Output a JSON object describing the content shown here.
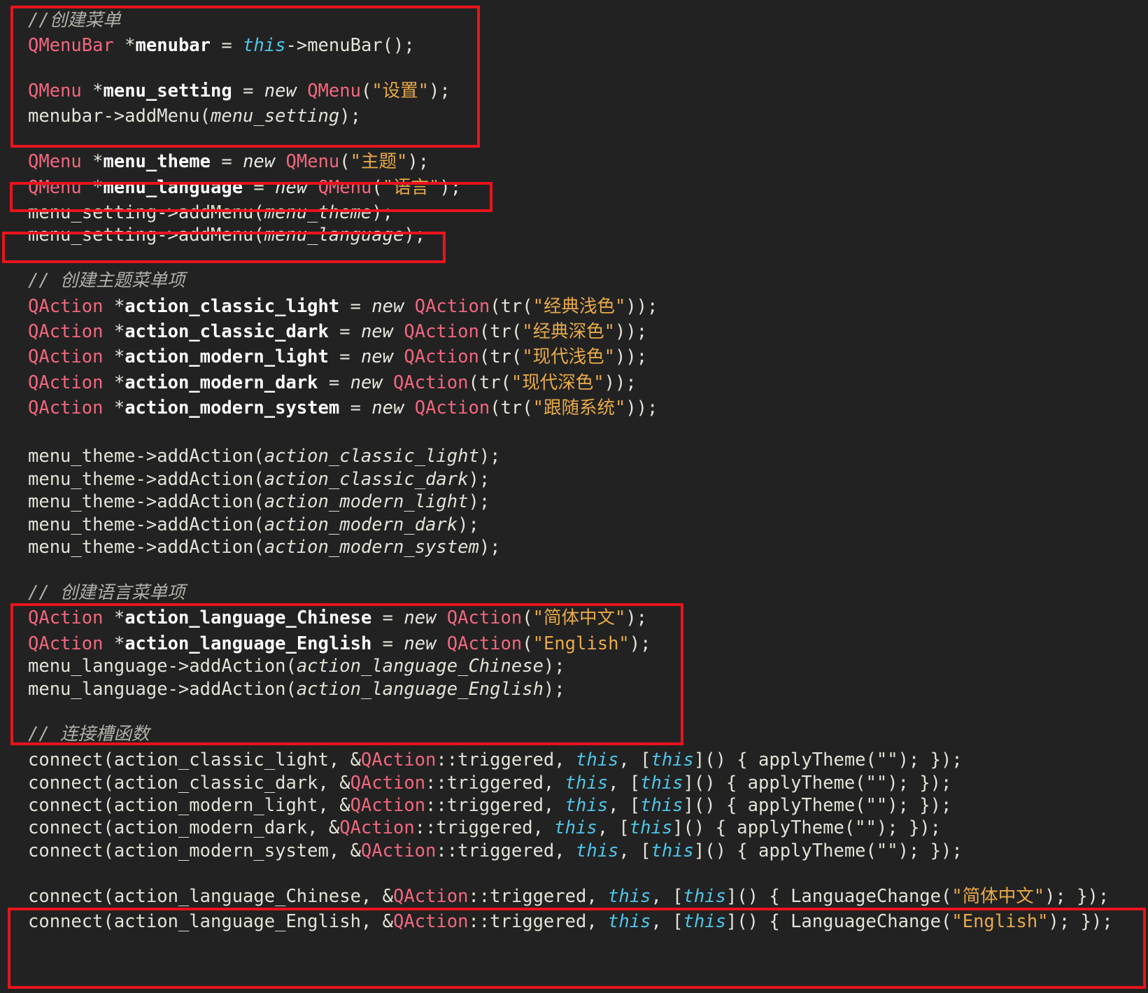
{
  "code": {
    "l1": {
      "comment": "//创建菜单"
    },
    "l2": {
      "type": "QMenuBar",
      "star": " *",
      "var": "menubar",
      "eq": " = ",
      "this": "this",
      "rest": "->menuBar();"
    },
    "l3": {
      "type": "QMenu",
      "star": " *",
      "var": "menu_setting",
      "eq": " = ",
      "new": "new",
      "sp": " ",
      "ctor": "QMenu",
      "open": "(",
      "str": "\"设置\"",
      "close": ");"
    },
    "l4": {
      "pre": "menubar->addMenu(",
      "arg": "menu_setting",
      "post": ");"
    },
    "l5": {
      "type": "QMenu",
      "star": " *",
      "var": "menu_theme",
      "eq": " = ",
      "new": "new",
      "sp": " ",
      "ctor": "QMenu",
      "open": "(",
      "str": "\"主题\"",
      "close": ");"
    },
    "l6": {
      "type": "QMenu",
      "star": " *",
      "var": "menu_language",
      "eq": " = ",
      "new": "new",
      "sp": " ",
      "ctor": "QMenu",
      "open": "(",
      "str": "\"语言\"",
      "close": ");"
    },
    "l7": {
      "pre": "menu_setting->addMenu(",
      "arg": "menu_theme",
      "post": ");"
    },
    "l8": {
      "pre": "menu_setting->addMenu(",
      "arg": "menu_language",
      "post": ");"
    },
    "l9": {
      "comment": "// 创建主题菜单项"
    },
    "l10": {
      "type": "QAction",
      "star": " *",
      "var": "action_classic_light",
      "eq": " = ",
      "new": "new",
      "sp": " ",
      "ctor": "QAction",
      "open": "(tr(",
      "str": "\"经典浅色\"",
      "close": "));"
    },
    "l11": {
      "type": "QAction",
      "star": " *",
      "var": "action_classic_dark",
      "eq": " = ",
      "new": "new",
      "sp": " ",
      "ctor": "QAction",
      "open": "(tr(",
      "str": "\"经典深色\"",
      "close": "));"
    },
    "l12": {
      "type": "QAction",
      "star": " *",
      "var": "action_modern_light",
      "eq": " = ",
      "new": "new",
      "sp": " ",
      "ctor": "QAction",
      "open": "(tr(",
      "str": "\"现代浅色\"",
      "close": "));"
    },
    "l13": {
      "type": "QAction",
      "star": " *",
      "var": "action_modern_dark",
      "eq": " = ",
      "new": "new",
      "sp": " ",
      "ctor": "QAction",
      "open": "(tr(",
      "str": "\"现代深色\"",
      "close": "));"
    },
    "l14": {
      "type": "QAction",
      "star": " *",
      "var": "action_modern_system",
      "eq": " = ",
      "new": "new",
      "sp": " ",
      "ctor": "QAction",
      "open": "(tr(",
      "str": "\"跟随系统\"",
      "close": "));"
    },
    "l15": {
      "pre": "menu_theme->addAction(",
      "arg": "action_classic_light",
      "post": ");"
    },
    "l16": {
      "pre": "menu_theme->addAction(",
      "arg": "action_classic_dark",
      "post": ");"
    },
    "l17": {
      "pre": "menu_theme->addAction(",
      "arg": "action_modern_light",
      "post": ");"
    },
    "l18": {
      "pre": "menu_theme->addAction(",
      "arg": "action_modern_dark",
      "post": ");"
    },
    "l19": {
      "pre": "menu_theme->addAction(",
      "arg": "action_modern_system",
      "post": ");"
    },
    "l20": {
      "comment": "// 创建语言菜单项"
    },
    "l21": {
      "type": "QAction",
      "star": " *",
      "var": "action_language_Chinese",
      "eq": " = ",
      "new": "new",
      "sp": " ",
      "ctor": "QAction",
      "open": "(",
      "str": "\"简体中文\"",
      "close": ");"
    },
    "l22": {
      "type": "QAction",
      "star": " *",
      "var": "action_language_English",
      "eq": " = ",
      "new": "new",
      "sp": " ",
      "ctor": "QAction",
      "open": "(",
      "str": "\"English\"",
      "close": ");"
    },
    "l23": {
      "pre": "menu_language->addAction(",
      "arg": "action_language_Chinese",
      "post": ");"
    },
    "l24": {
      "pre": "menu_language->addAction(",
      "arg": "action_language_English",
      "post": ");"
    },
    "l25": {
      "comment": "// 连接槽函数"
    },
    "l26": {
      "pre": "connect(action_classic_light, &",
      "cls": "QAction",
      "mid": "::triggered, ",
      "this1": "this",
      "sep": ", [",
      "this2": "this",
      "post": "]() { applyTheme(\"\"); });"
    },
    "l27": {
      "pre": "connect(action_classic_dark, &",
      "cls": "QAction",
      "mid": "::triggered, ",
      "this1": "this",
      "sep": ", [",
      "this2": "this",
      "post": "]() { applyTheme(\"\"); });"
    },
    "l28": {
      "pre": "connect(action_modern_light, &",
      "cls": "QAction",
      "mid": "::triggered, ",
      "this1": "this",
      "sep": ", [",
      "this2": "this",
      "post": "]() { applyTheme(\"\"); });"
    },
    "l29": {
      "pre": "connect(action_modern_dark, &",
      "cls": "QAction",
      "mid": "::triggered, ",
      "this1": "this",
      "sep": ", [",
      "this2": "this",
      "post": "]() { applyTheme(\"\"); });"
    },
    "l30": {
      "pre": "connect(action_modern_system, &",
      "cls": "QAction",
      "mid": "::triggered, ",
      "this1": "this",
      "sep": ", [",
      "this2": "this",
      "post": "]() { applyTheme(\"\"); });"
    },
    "l31": {
      "pre": "connect(action_language_Chinese, &",
      "cls": "QAction",
      "mid": "::triggered, ",
      "this1": "this",
      "sep": ", [",
      "this2": "this",
      "fn": "]() { LanguageChange(",
      "str": "\"简体中文\"",
      "post": "); });"
    },
    "l32": {
      "pre": "connect(action_language_English, &",
      "cls": "QAction",
      "mid": "::triggered, ",
      "this1": "this",
      "sep": ", [",
      "this2": "this",
      "fn": "]() { LanguageChange(",
      "str": "\"English\"",
      "post": "); });"
    }
  },
  "colors": {
    "background": "#222222",
    "highlight_box": "#e8141e",
    "type": "#f2677e",
    "string": "#e8aa4a",
    "this_keyword": "#4fc6e8",
    "comment": "#b0b0a8",
    "text": "#e2e2d8"
  }
}
